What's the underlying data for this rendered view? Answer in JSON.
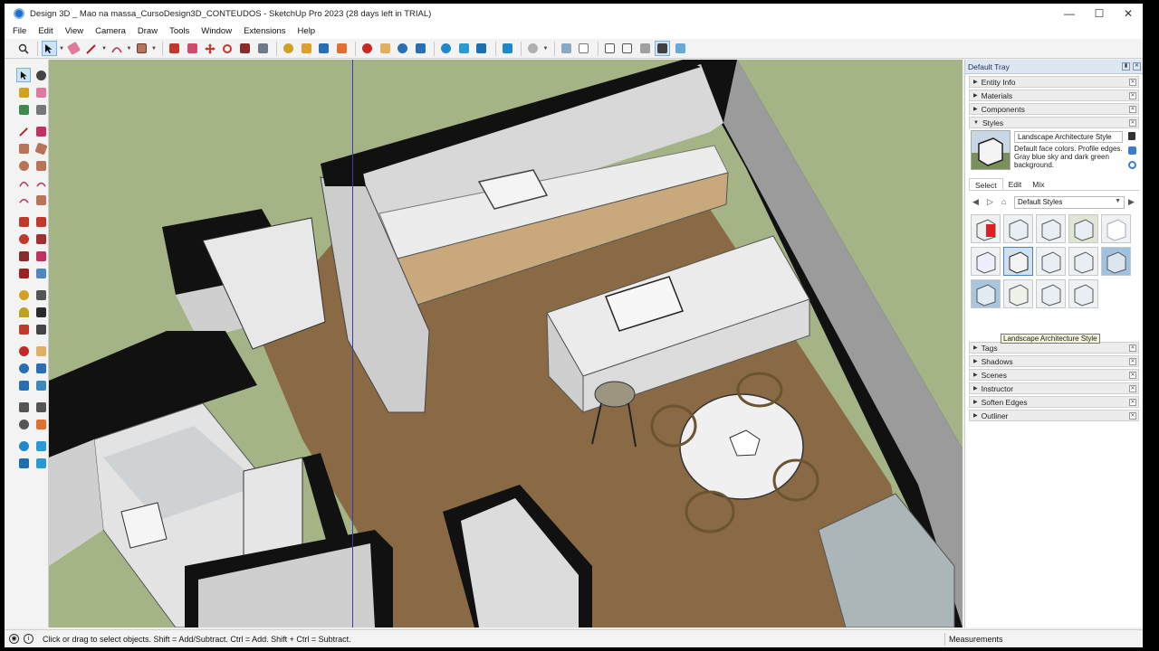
{
  "window": {
    "title": "Design 3D _ Mao na massa_CursoDesign3D_CONTEUDOS - SketchUp Pro 2023 (28 days left in TRIAL)",
    "minimize": "—",
    "maximize": "☐",
    "close": "✕"
  },
  "menu": [
    "File",
    "Edit",
    "View",
    "Camera",
    "Draw",
    "Tools",
    "Window",
    "Extensions",
    "Help"
  ],
  "tray": {
    "title": "Default Tray",
    "panels_top": [
      "Entity Info",
      "Materials",
      "Components",
      "Styles"
    ],
    "styles": {
      "style_name": "Landscape Architecture Style",
      "description": "Default face colors. Profile edges. Gray blue sky and dark green background.",
      "tabs": [
        "Select",
        "Edit",
        "Mix"
      ],
      "active_tab": "Select",
      "collection": "Default Styles",
      "tooltip": "Landscape Architecture Style"
    },
    "panels_bottom": [
      "Tags",
      "Shadows",
      "Scenes",
      "Instructor",
      "Soften Edges",
      "Outliner"
    ]
  },
  "status": {
    "hint": "Click or drag to select objects. Shift = Add/Subtract. Ctrl = Add. Shift + Ctrl = Subtract.",
    "measurements_label": "Measurements"
  },
  "colors": {
    "sky": "#a4b487",
    "floor": "#8a6a45",
    "wall_cut": "#111111",
    "counter": "#e8e8e8",
    "cabinet": "#c9a97c",
    "sofa": "#aab6b8",
    "selection": "#cfe3f7"
  }
}
